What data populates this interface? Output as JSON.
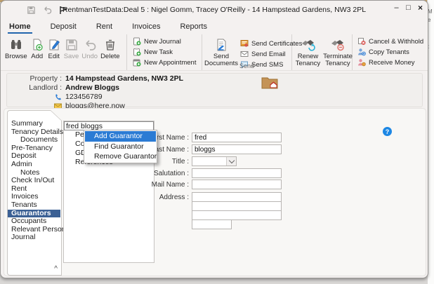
{
  "window": {
    "title": "RentmanTestData:Deal 5 : Nigel Gomm, Tracey O'Reilly - 14 Hampstead Gardens, NW3 2PL",
    "minimize_glyph": "–",
    "maximize_glyph": "□",
    "close_glyph": "×"
  },
  "background_fragments": {
    "frag1": "M",
    "frag2": "e",
    "frag3": ":"
  },
  "tabs": [
    {
      "label": "Home"
    },
    {
      "label": "Deposit"
    },
    {
      "label": "Rent"
    },
    {
      "label": "Invoices"
    },
    {
      "label": "Reports"
    }
  ],
  "ribbon": {
    "edit_group": {
      "browse": "Browse",
      "add": "Add",
      "edit": "Edit",
      "save": "Save",
      "undo": "Undo",
      "delete": "Delete"
    },
    "new_group": {
      "journal": "New Journal",
      "task": "New Task",
      "appointment": "New Appointment"
    },
    "send_group": {
      "group_label": "Send",
      "documents": "Send Documents",
      "certificates": "Send Certificates",
      "email": "Send Email",
      "sms": "Send SMS"
    },
    "tenancy_group": {
      "renew": "Renew Tenancy",
      "terminate": "Terminate Tenancy"
    },
    "money_group": {
      "cancel": "Cancel & Withhold",
      "copy": "Copy Tenants",
      "receive": "Receive Money"
    }
  },
  "property_panel": {
    "property_label": "Property :",
    "property_value": "14 Hampstead Gardens, NW3 2PL",
    "landlord_label": "Landlord :",
    "landlord_value": "Andrew Bloggs",
    "phone": "123456789",
    "email": "bloggs@here.now"
  },
  "sidebar": {
    "items": [
      {
        "label": "Summary"
      },
      {
        "label": "Tenancy Details"
      },
      {
        "label": "Documents"
      },
      {
        "label": "Pre-Tenancy"
      },
      {
        "label": "Deposit"
      },
      {
        "label": "Admin"
      },
      {
        "label": "Notes"
      },
      {
        "label": "Check In/Out"
      },
      {
        "label": "Rent"
      },
      {
        "label": "Invoices"
      },
      {
        "label": "Tenants"
      },
      {
        "label": "Guarantors"
      },
      {
        "label": "Occupants"
      },
      {
        "label": "Relevant Persons"
      },
      {
        "label": "Journal"
      }
    ],
    "collapse_arrow": "^"
  },
  "guarantor_tree": {
    "root": "fred bloggs",
    "children": [
      {
        "label": "Personal"
      },
      {
        "label": "Contact"
      },
      {
        "label": "GDPR"
      },
      {
        "label": "References"
      }
    ]
  },
  "context_menu": {
    "items": [
      {
        "label": "Add Guarantor"
      },
      {
        "label": "Find Guarantor"
      },
      {
        "label": "Remove Guarantor"
      }
    ]
  },
  "form": {
    "first_name": {
      "label": "First Name :",
      "value": "fred"
    },
    "last_name": {
      "label": "Last Name :",
      "value": "bloggs"
    },
    "title": {
      "label": "Title :",
      "value": ""
    },
    "salutation": {
      "label": "Salutation :",
      "value": ""
    },
    "mail_name": {
      "label": "Mail Name :",
      "value": ""
    },
    "address": {
      "label": "Address :",
      "line1": "",
      "line2": "",
      "line3": "",
      "postcode": ""
    }
  },
  "help": {
    "glyph": "?"
  },
  "colors": {
    "accent_blue": "#2165ad",
    "sidebar_selected": "#3b6094",
    "menu_highlight": "#2b7bd4",
    "green_accent": "#3fae49",
    "red_accent": "#d9534f",
    "orange_accent": "#e8a33d"
  }
}
